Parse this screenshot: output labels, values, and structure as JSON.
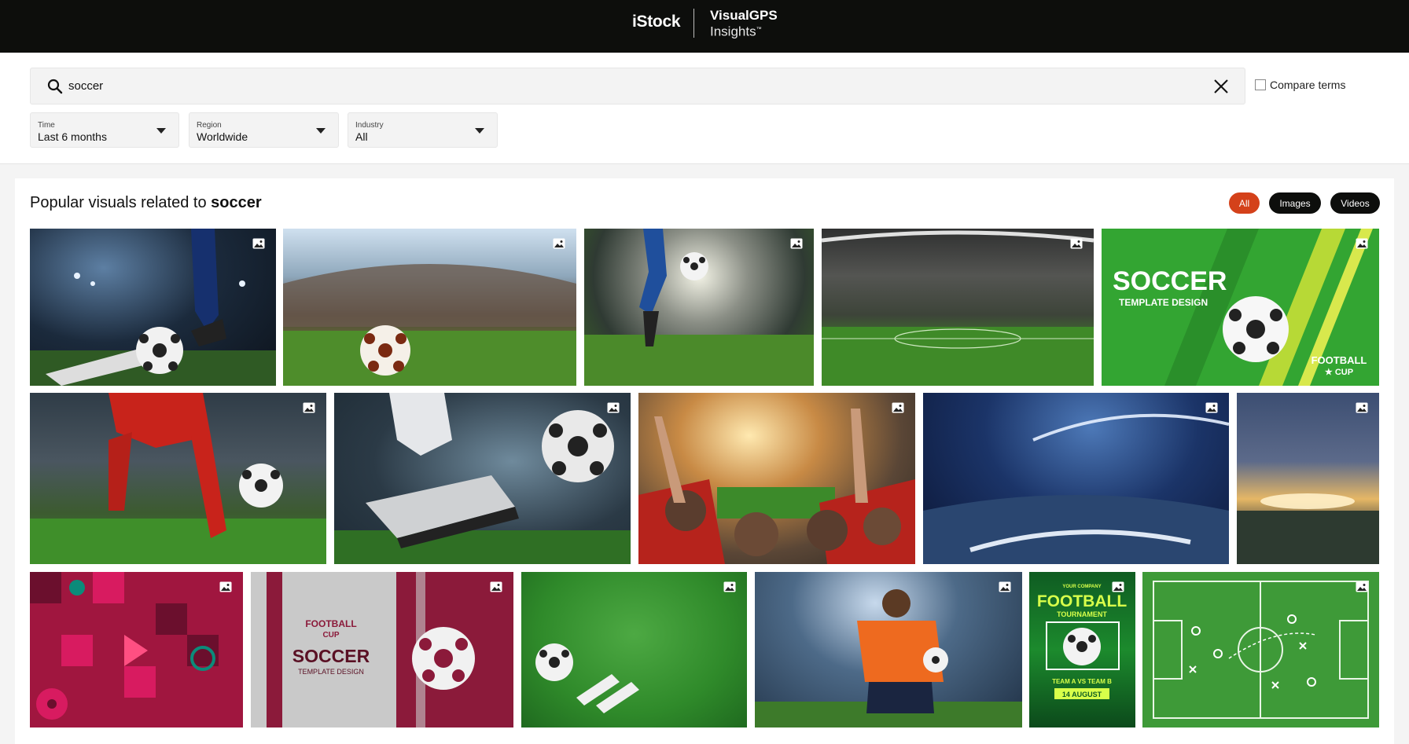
{
  "header": {
    "brand_istock": "iStock",
    "brand_visualgps": "VisualGPS",
    "brand_insights": "Insights",
    "brand_tm": "™"
  },
  "search": {
    "value": "soccer",
    "placeholder": "",
    "search_icon": "search-icon",
    "clear_icon": "close-icon"
  },
  "compare": {
    "label": "Compare terms",
    "checked": false
  },
  "filters": [
    {
      "caption": "Time",
      "value": "Last 6 months"
    },
    {
      "caption": "Region",
      "value": "Worldwide"
    },
    {
      "caption": "Industry",
      "value": "All"
    }
  ],
  "results": {
    "heading_prefix": "Popular visuals related to ",
    "heading_term": "soccer",
    "tabs": [
      {
        "label": "All",
        "active": true
      },
      {
        "label": "Images",
        "active": false
      },
      {
        "label": "Videos",
        "active": false
      }
    ],
    "tile_badge_icon": "image-icon"
  },
  "colors": {
    "topbar": "#0d0e0c",
    "accent": "#d4411a",
    "pill_dark": "#0d0e0c"
  },
  "images": [
    {
      "name": "tile-player-kicking-ball-night"
    },
    {
      "name": "tile-ball-on-stadium-pitch"
    },
    {
      "name": "tile-player-kick-stadium-lights"
    },
    {
      "name": "tile-empty-stadium-floodlights"
    },
    {
      "name": "tile-soccer-template-design"
    },
    {
      "name": "tile-player-red-kit-ball"
    },
    {
      "name": "tile-boot-and-ball-closeup"
    },
    {
      "name": "tile-fans-cheering"
    },
    {
      "name": "tile-stadium-night-sky"
    },
    {
      "name": "tile-stadium-glow"
    },
    {
      "name": "tile-geometric-pattern"
    },
    {
      "name": "tile-football-cup-poster"
    },
    {
      "name": "tile-ball-and-boots-on-grass"
    },
    {
      "name": "tile-player-celebrating"
    },
    {
      "name": "tile-football-tournament-flyer"
    },
    {
      "name": "tile-tactics-board"
    }
  ],
  "posters": {
    "template": {
      "title": "SOCCER",
      "subtitle": "TEMPLATE DESIGN",
      "badge_line1": "FOOTBALL",
      "badge_line2": "★ CUP"
    },
    "cup_poster": {
      "line1": "FOOTBALL",
      "line2": "CUP",
      "title": "SOCCER",
      "subtitle": "TEMPLATE DESIGN"
    },
    "flyer": {
      "top": "YOUR COMPANY",
      "title": "FOOTBALL",
      "subtitle": "TOURNAMENT",
      "teams": "TEAM A  VS  TEAM B",
      "date": "14 AUGUST"
    }
  }
}
